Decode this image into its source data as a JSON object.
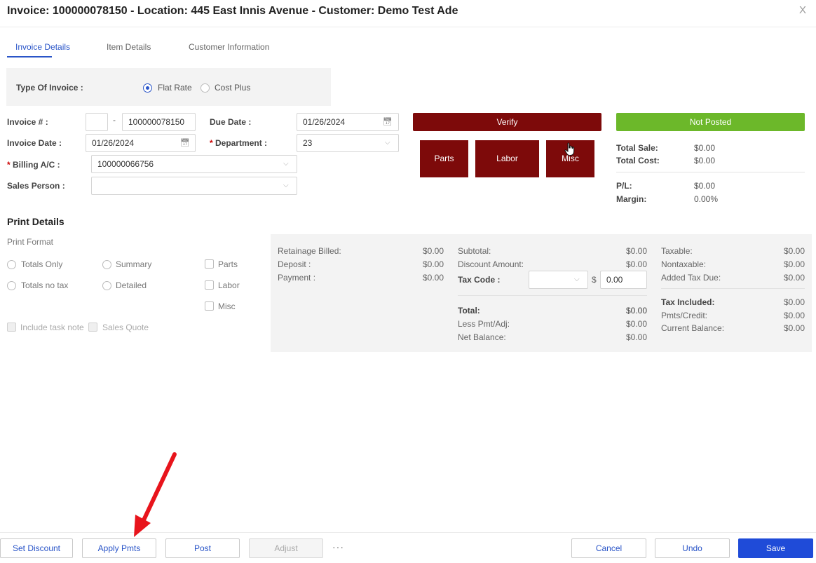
{
  "window": {
    "title": "Invoice: 100000078150 - Location: 445 East Innis Avenue - Customer: Demo Test Ade",
    "close_label": "X"
  },
  "tabs": [
    {
      "label": "Invoice Details"
    },
    {
      "label": "Item Details"
    },
    {
      "label": "Customer Information"
    }
  ],
  "type_of_invoice": {
    "label": "Type Of Invoice :",
    "options": [
      {
        "label": "Flat Rate",
        "selected": true
      },
      {
        "label": "Cost Plus",
        "selected": false
      }
    ]
  },
  "form": {
    "invoice_no_label": "Invoice # :",
    "invoice_prefix_value": "",
    "invoice_dash": "-",
    "invoice_no_value": "100000078150",
    "due_date_label": "Due Date :",
    "due_date_value": "01/26/2024",
    "invoice_date_label": "Invoice Date :",
    "invoice_date_value": "01/26/2024",
    "department_required": "*",
    "department_label": "Department :",
    "department_value": "23",
    "billing_required": "*",
    "billing_label": "Billing A/C :",
    "billing_value": "100000066756",
    "sales_person_label": "Sales Person :",
    "sales_person_value": ""
  },
  "actions": {
    "verify_label": "Verify",
    "status_label": "Not Posted",
    "parts_label": "Parts",
    "labor_label": "Labor",
    "misc_label": "Misc"
  },
  "summary": {
    "total_sale_label": "Total Sale:",
    "total_sale_value": "$0.00",
    "total_cost_label": "Total Cost:",
    "total_cost_value": "$0.00",
    "pl_label": "P/L:",
    "pl_value": "$0.00",
    "margin_label": "Margin:",
    "margin_value": "0.00%"
  },
  "print_details": {
    "title": "Print Details",
    "format_label": "Print Format",
    "totals_only": "Totals Only",
    "summary": "Summary",
    "parts": "Parts",
    "totals_no_tax": "Totals no tax",
    "detailed": "Detailed",
    "labor": "Labor",
    "misc": "Misc",
    "include_task_note": "Include task note",
    "sales_quote": "Sales Quote"
  },
  "totals": {
    "retainage_billed_label": "Retainage Billed:",
    "retainage_billed_value": "$0.00",
    "deposit_label": "Deposit :",
    "deposit_value": "$0.00",
    "payment_label": "Payment :",
    "payment_value": "$0.00",
    "subtotal_label": "Subtotal:",
    "subtotal_value": "$0.00",
    "discount_amount_label": "Discount Amount:",
    "discount_amount_value": "$0.00",
    "tax_code_label": "Tax Code :",
    "tax_code_value": "",
    "tax_currency": "$",
    "tax_rate_value": "0.00",
    "total_label": "Total:",
    "total_value": "$0.00",
    "less_pmt_label": "Less Pmt/Adj:",
    "less_pmt_value": "$0.00",
    "net_balance_label": "Net Balance:",
    "net_balance_value": "$0.00",
    "taxable_label": "Taxable:",
    "taxable_value": "$0.00",
    "nontaxable_label": "Nontaxable:",
    "nontaxable_value": "$0.00",
    "added_tax_label": "Added Tax Due:",
    "added_tax_value": "$0.00",
    "tax_included_label": "Tax Included:",
    "tax_included_value": "$0.00",
    "pmts_credit_label": "Pmts/Credit:",
    "pmts_credit_value": "$0.00",
    "current_balance_label": "Current Balance:",
    "current_balance_value": "$0.00"
  },
  "footer": {
    "set_discount": "Set Discount",
    "apply_pmts": "Apply Pmts",
    "post": "Post",
    "adjust": "Adjust",
    "more": "···",
    "cancel": "Cancel",
    "undo": "Undo",
    "save": "Save"
  },
  "colors": {
    "accent_blue": "#2a55c8",
    "primary_button": "#1f4bd8",
    "maroon_button": "#7d0a0a",
    "status_green": "#6cb82a",
    "annotation_arrow": "#e8141c"
  },
  "icons": [
    "close-icon",
    "calendar-icon",
    "chevron-down-icon",
    "hand-cursor-icon",
    "annotation-arrow"
  ]
}
